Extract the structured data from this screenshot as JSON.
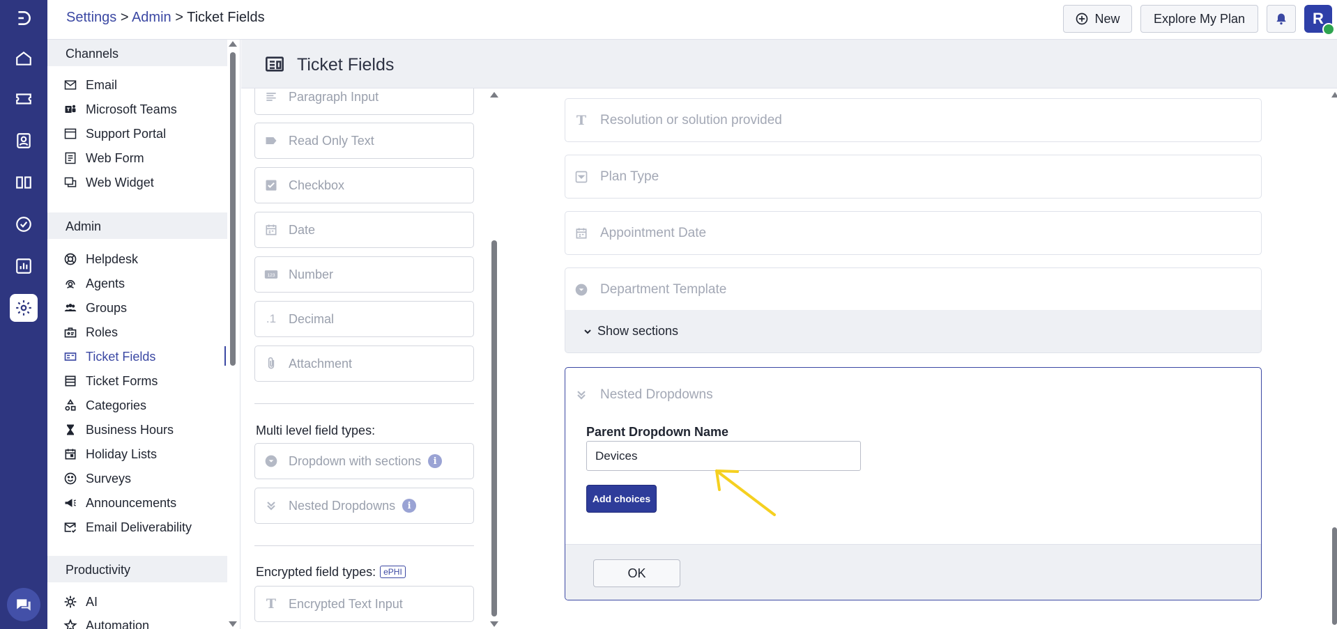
{
  "breadcrumb": {
    "part1": "Settings",
    "sep1": " > ",
    "part2": "Admin",
    "sep2": " > ",
    "part3": "Ticket Fields"
  },
  "topbar": {
    "new_label": "New",
    "explore_label": "Explore My Plan",
    "avatar_initial": "R"
  },
  "sidebar": {
    "channels_heading": "Channels",
    "channels": [
      {
        "label": "Email",
        "icon": "mail-icon"
      },
      {
        "label": "Microsoft Teams",
        "icon": "teams-icon"
      },
      {
        "label": "Support Portal",
        "icon": "portal-icon"
      },
      {
        "label": "Web Form",
        "icon": "form-icon"
      },
      {
        "label": "Web Widget",
        "icon": "widget-icon"
      }
    ],
    "admin_heading": "Admin",
    "admin": [
      {
        "label": "Helpdesk",
        "icon": "helpdesk-icon"
      },
      {
        "label": "Agents",
        "icon": "agents-icon"
      },
      {
        "label": "Groups",
        "icon": "groups-icon"
      },
      {
        "label": "Roles",
        "icon": "roles-icon"
      },
      {
        "label": "Ticket Fields",
        "icon": "ticket-fields-icon",
        "active": true
      },
      {
        "label": "Ticket Forms",
        "icon": "ticket-forms-icon"
      },
      {
        "label": "Categories",
        "icon": "categories-icon"
      },
      {
        "label": "Business Hours",
        "icon": "hourglass-icon"
      },
      {
        "label": "Holiday Lists",
        "icon": "calendar-icon"
      },
      {
        "label": "Surveys",
        "icon": "smiley-icon"
      },
      {
        "label": "Announcements",
        "icon": "megaphone-icon"
      },
      {
        "label": "Email Deliverability",
        "icon": "mail-check-icon"
      }
    ],
    "productivity_heading": "Productivity",
    "productivity": [
      {
        "label": "AI",
        "icon": "ai-icon"
      },
      {
        "label": "Automation",
        "icon": "automation-icon"
      }
    ]
  },
  "main": {
    "title": "Ticket Fields"
  },
  "field_types": {
    "items": [
      {
        "label": "Paragraph Input"
      },
      {
        "label": "Read Only Text"
      },
      {
        "label": "Checkbox"
      },
      {
        "label": "Date"
      },
      {
        "label": "Number"
      },
      {
        "label": "Decimal"
      },
      {
        "label": "Attachment"
      }
    ],
    "multi_level_label": "Multi level field types:",
    "multi_level": [
      {
        "label": "Dropdown with sections"
      },
      {
        "label": "Nested Dropdowns"
      }
    ],
    "encrypted_label": "Encrypted field types:",
    "encrypted_badge": "ePHI",
    "encrypted": [
      {
        "label": "Encrypted Text Input"
      }
    ]
  },
  "form": {
    "fields": [
      {
        "label": "Resolution or solution provided",
        "icon": "text-icon"
      },
      {
        "label": "Plan Type",
        "icon": "dropdown-icon"
      },
      {
        "label": "Appointment Date",
        "icon": "calendar-icon"
      },
      {
        "label": "Department Template",
        "icon": "dropdown-circle-icon"
      }
    ],
    "show_sections": "Show sections",
    "nested": {
      "title": "Nested Dropdowns",
      "parent_label": "Parent Dropdown Name",
      "parent_value": "Devices",
      "add_choices": "Add choices",
      "ok": "OK"
    }
  },
  "colors": {
    "rail": "#2e3680",
    "accent": "#3b48a3",
    "arrow": "#f5d020"
  }
}
